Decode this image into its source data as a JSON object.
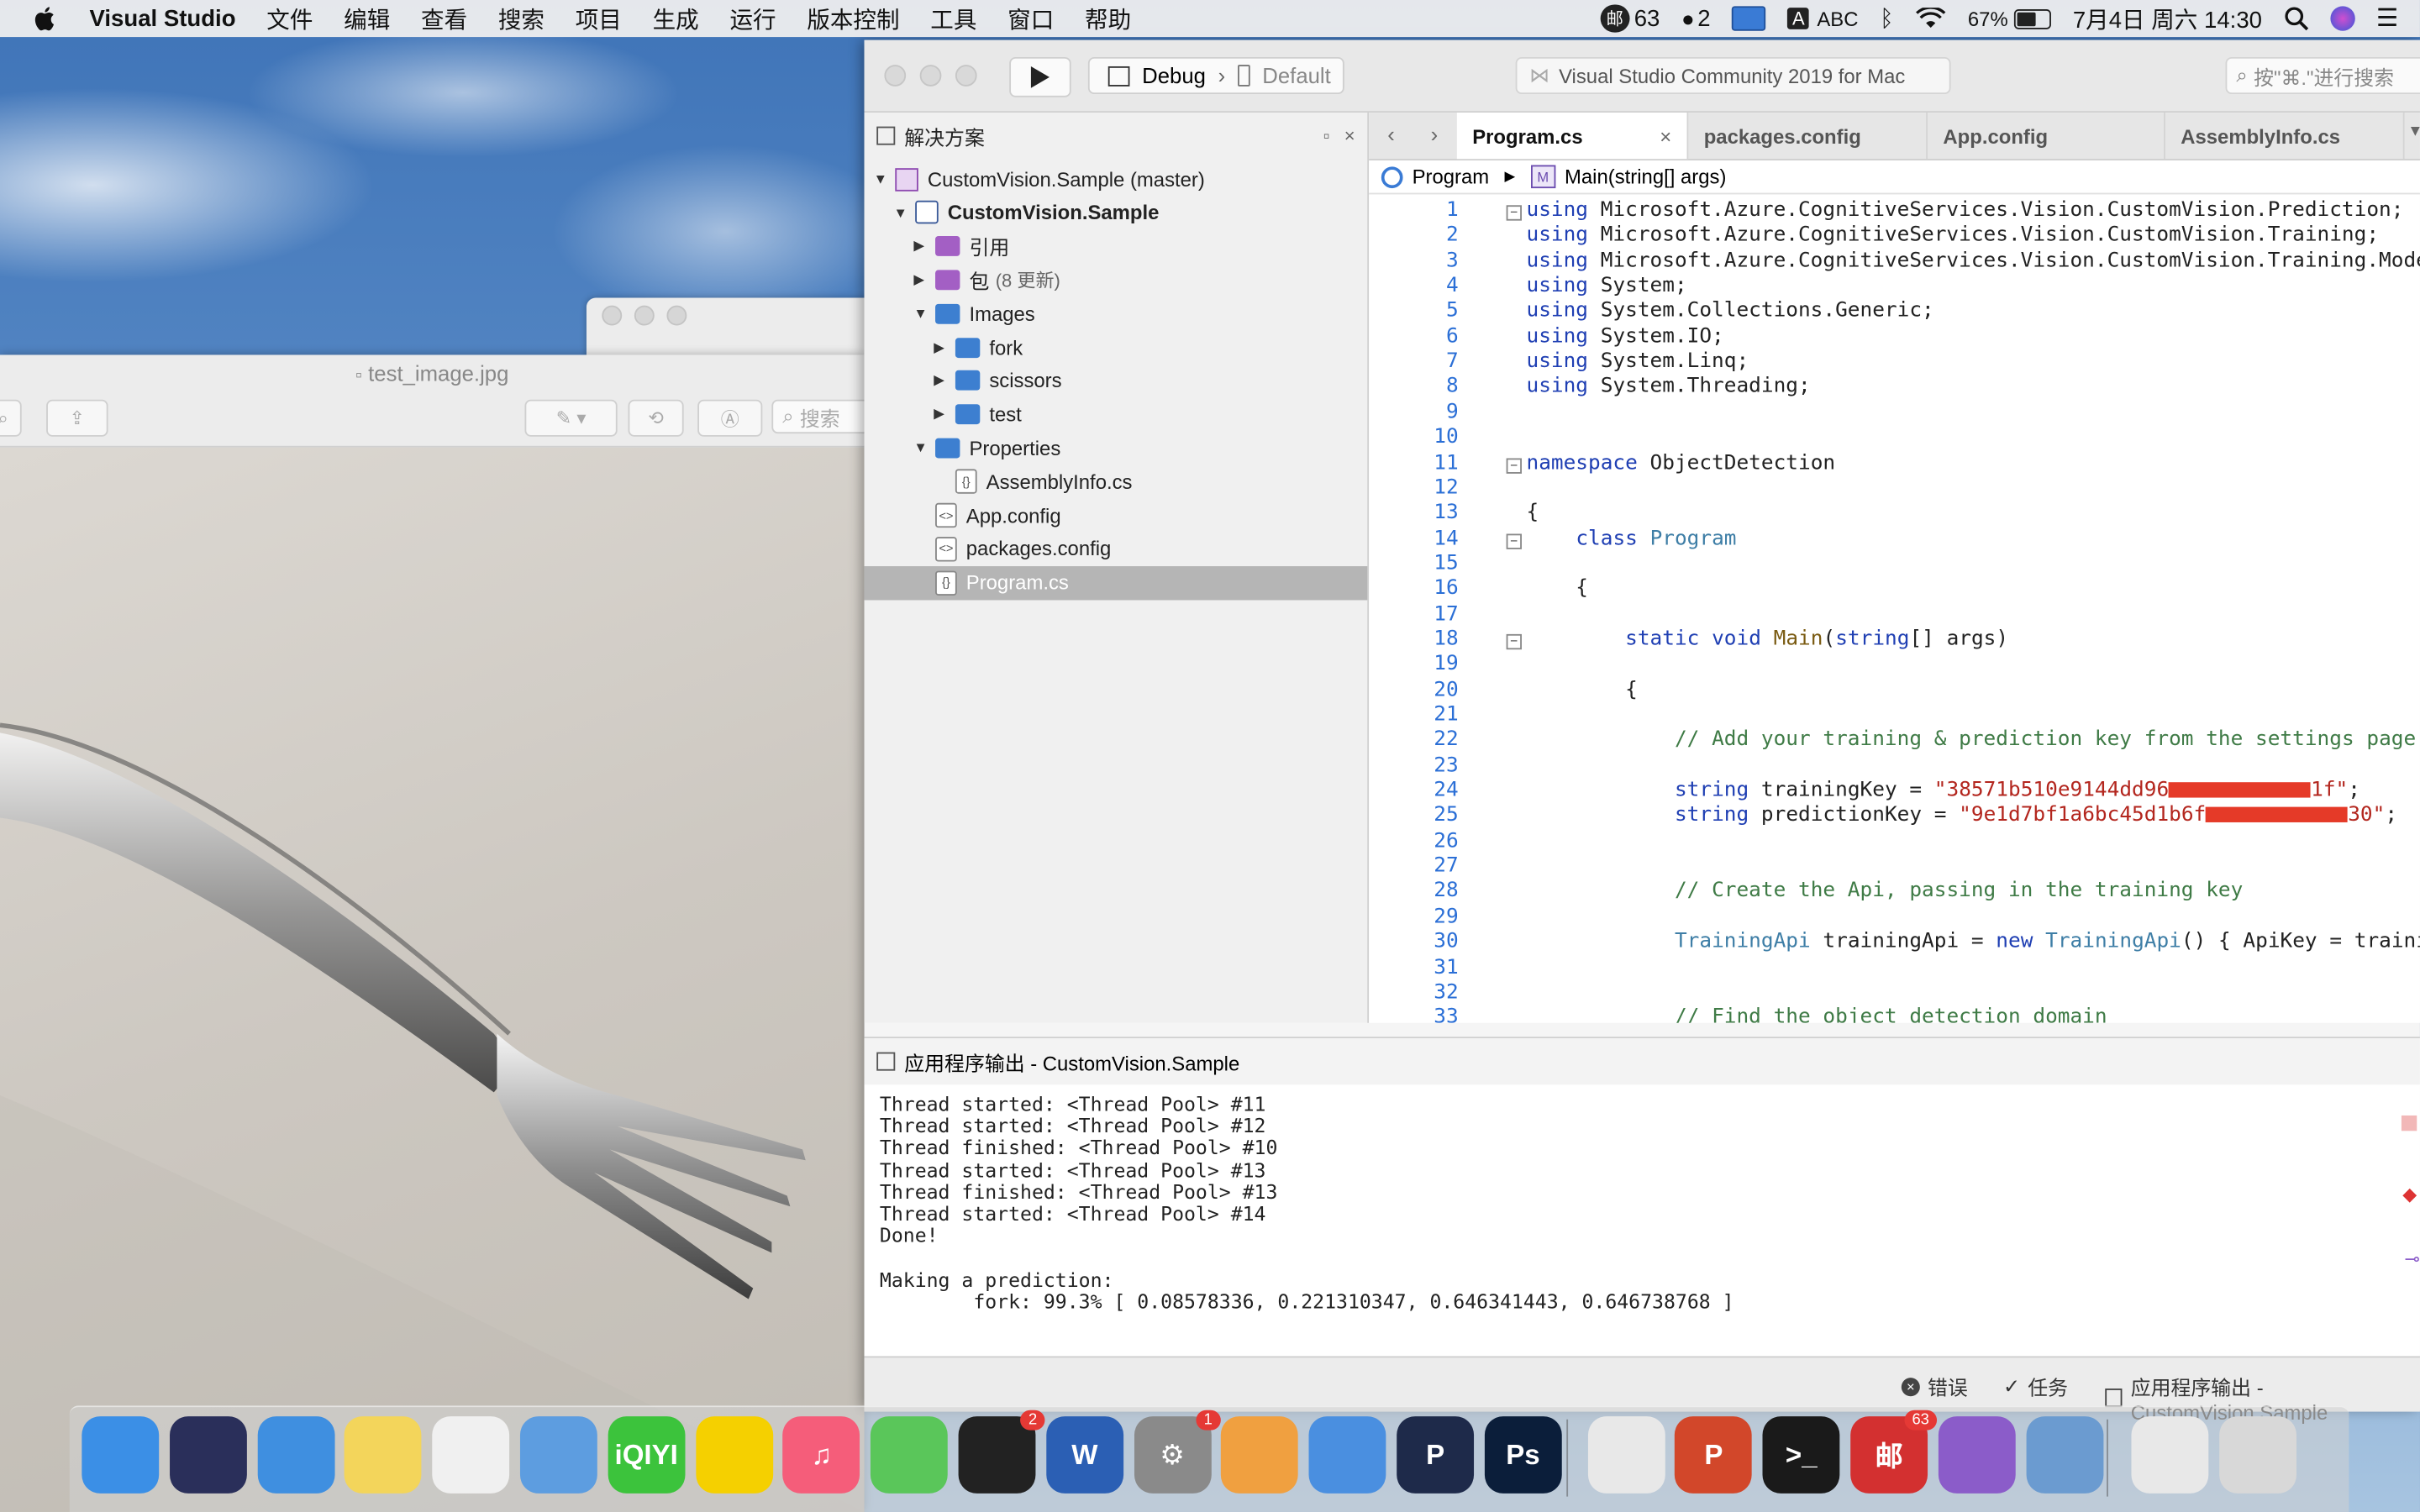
{
  "menubar": {
    "app_name": "Visual Studio",
    "menus": [
      "文件",
      "编辑",
      "查看",
      "搜索",
      "项目",
      "生成",
      "运行",
      "版本控制",
      "工具",
      "窗口",
      "帮助"
    ],
    "status": {
      "mail_badge": "63",
      "qq_badge": "2",
      "input_method": "ABC",
      "battery": "67%",
      "battery_level": 0.67,
      "datetime": "7月4日 周六  14:30"
    }
  },
  "preview": {
    "title": "test_image.jpg",
    "search_placeholder": "搜索"
  },
  "vs": {
    "config": "Debug",
    "target": "Default",
    "window_title": "Visual Studio Community 2019 for Mac",
    "search_placeholder": "按\"⌘.\"进行搜索",
    "solution_pad_title": "解决方案",
    "tree": [
      {
        "label": "CustomVision.Sample (master)",
        "level": 0,
        "arrow": "▼",
        "icon": "solution-icon"
      },
      {
        "label": "CustomVision.Sample",
        "level": 1,
        "arrow": "▼",
        "icon": "project-icon",
        "bold": true
      },
      {
        "label": "引用",
        "level": 2,
        "arrow": "▶",
        "icon": "references-icon"
      },
      {
        "label": "包",
        "extra": "(8 更新)",
        "level": 2,
        "arrow": "▶",
        "icon": "packages-icon"
      },
      {
        "label": "Images",
        "level": 2,
        "arrow": "▼",
        "icon": "folder-icon"
      },
      {
        "label": "fork",
        "level": 3,
        "arrow": "▶",
        "icon": "folder-icon"
      },
      {
        "label": "scissors",
        "level": 3,
        "arrow": "▶",
        "icon": "folder-icon"
      },
      {
        "label": "test",
        "level": 3,
        "arrow": "▶",
        "icon": "folder-icon"
      },
      {
        "label": "Properties",
        "level": 2,
        "arrow": "▼",
        "icon": "folder-icon"
      },
      {
        "label": "AssemblyInfo.cs",
        "level": 3,
        "arrow": "",
        "icon": "cs-file-icon"
      },
      {
        "label": "App.config",
        "level": 2,
        "arrow": "",
        "icon": "config-file-icon"
      },
      {
        "label": "packages.config",
        "level": 2,
        "arrow": "",
        "icon": "config-file-icon"
      },
      {
        "label": "Program.cs",
        "level": 2,
        "arrow": "",
        "icon": "cs-file-icon",
        "selected": true
      }
    ],
    "tabs": [
      {
        "label": "Program.cs",
        "active": true
      },
      {
        "label": "packages.config"
      },
      {
        "label": "App.config"
      },
      {
        "label": "AssemblyInfo.cs"
      }
    ],
    "breadcrumb": {
      "class_name": "Program",
      "method": "Main(string[] args)"
    },
    "code_lines": [
      {
        "n": "1",
        "fold": true,
        "text": "using Microsoft.Azure.CognitiveServices.Vision.CustomVision.Prediction;"
      },
      {
        "n": "2",
        "text": "using Microsoft.Azure.CognitiveServices.Vision.CustomVision.Training;"
      },
      {
        "n": "3",
        "text": "using Microsoft.Azure.CognitiveServices.Vision.CustomVision.Training.Models;"
      },
      {
        "n": "4",
        "text": "using System;"
      },
      {
        "n": "5",
        "text": "using System.Collections.Generic;"
      },
      {
        "n": "6",
        "text": "using System.IO;"
      },
      {
        "n": "7",
        "text": "using System.Linq;"
      },
      {
        "n": "8",
        "text": "using System.Threading;"
      },
      {
        "n": "9",
        "text": ""
      },
      {
        "n": "10",
        "text": ""
      },
      {
        "n": "11",
        "fold": true,
        "text": "namespace ObjectDetection"
      },
      {
        "n": "12",
        "text": ""
      },
      {
        "n": "13",
        "text": "{"
      },
      {
        "n": "14",
        "fold": true,
        "text": "    class Program"
      },
      {
        "n": "15",
        "text": ""
      },
      {
        "n": "16",
        "text": "    {"
      },
      {
        "n": "17",
        "text": ""
      },
      {
        "n": "18",
        "fold": true,
        "text": "        static void Main(string[] args)"
      },
      {
        "n": "19",
        "text": ""
      },
      {
        "n": "20",
        "text": "        {"
      },
      {
        "n": "21",
        "text": ""
      },
      {
        "n": "22",
        "text": "            // Add your training & prediction key from the settings page of the portal"
      },
      {
        "n": "23",
        "text": ""
      },
      {
        "n": "24",
        "text": "            string trainingKey = \"38571b510e9144dd961f\";"
      },
      {
        "n": "25",
        "text": "            string predictionKey = \"9e1d7bf1a6bc45d1b6f30\";"
      },
      {
        "n": "26",
        "text": ""
      },
      {
        "n": "27",
        "text": ""
      },
      {
        "n": "28",
        "text": "            // Create the Api, passing in the training key"
      },
      {
        "n": "29",
        "text": ""
      },
      {
        "n": "30",
        "text": "            TrainingApi trainingApi = new TrainingApi() { ApiKey = trainingKey };"
      },
      {
        "n": "31",
        "text": ""
      },
      {
        "n": "32",
        "text": ""
      },
      {
        "n": "33",
        "text": "            // Find the object detection domain"
      }
    ],
    "output": {
      "title": "应用程序输出 - CustomVision.Sample",
      "lines": [
        "Thread started: <Thread Pool> #11",
        "Thread started: <Thread Pool> #12",
        "Thread finished: <Thread Pool> #10",
        "Thread started: <Thread Pool> #13",
        "Thread finished: <Thread Pool> #13",
        "Thread started: <Thread Pool> #14",
        "Done!",
        "",
        "Making a prediction:",
        "        fork: 99.3% [ 0.08578336, 0.221310347, 0.646341443, 0.646738768 ]"
      ]
    },
    "statusbar": {
      "errors": "错误",
      "tasks": "任务",
      "app_output": "应用程序输出 - CustomVision.Sample"
    }
  },
  "dock": {
    "apps": [
      {
        "name": "Finder",
        "color": "#3b8fe6",
        "glyph": ""
      },
      {
        "name": "Siri",
        "color": "#2a2f5a",
        "glyph": ""
      },
      {
        "name": "Safari",
        "color": "#3f8fe0",
        "glyph": ""
      },
      {
        "name": "Notes",
        "color": "#f3d55b",
        "glyph": ""
      },
      {
        "name": "Photos",
        "color": "#f0f0f0",
        "glyph": ""
      },
      {
        "name": "Keynote",
        "color": "#5d9de0",
        "glyph": ""
      },
      {
        "name": "iQIYI",
        "color": "#3cc33c",
        "glyph": "iQIYI"
      },
      {
        "name": "QQ Music",
        "color": "#f5d000",
        "glyph": ""
      },
      {
        "name": "Music",
        "color": "#f55d7a",
        "glyph": "♫"
      },
      {
        "name": "WeChat",
        "color": "#5ac65a",
        "glyph": ""
      },
      {
        "name": "QQ",
        "color": "#222222",
        "glyph": "",
        "badge": "2"
      },
      {
        "name": "Word",
        "color": "#2b5fb4",
        "glyph": "W"
      },
      {
        "name": "System Preferences",
        "color": "#8a8a8a",
        "glyph": "⚙",
        "badge": "1"
      },
      {
        "name": "Pages",
        "color": "#f0a040",
        "glyph": ""
      },
      {
        "name": "Xcode",
        "color": "#4a8fe0",
        "glyph": ""
      },
      {
        "name": "P App",
        "color": "#1e2a4a",
        "glyph": "P"
      },
      {
        "name": "Photoshop",
        "color": "#0b1e3a",
        "glyph": "Ps"
      },
      {
        "name": "Chrome",
        "color": "#e8e8e8",
        "glyph": ""
      },
      {
        "name": "PowerPoint",
        "color": "#d2472a",
        "glyph": "P"
      },
      {
        "name": "Terminal",
        "color": "#1a1a1a",
        "glyph": ">_"
      },
      {
        "name": "NetEase Mail",
        "color": "#d33030",
        "glyph": "邮",
        "badge": "63"
      },
      {
        "name": "Visual Studio",
        "color": "#8b5cc9",
        "glyph": ""
      },
      {
        "name": "Preview",
        "color": "#6b9bd0",
        "glyph": ""
      },
      {
        "name": "Documents",
        "color": "#e8e8e8",
        "glyph": ""
      },
      {
        "name": "Trash",
        "color": "#d8d8d8",
        "glyph": ""
      }
    ]
  },
  "colors": {
    "accent": "#3d7fd0",
    "selection": "#b5b5b5",
    "redaction": "#e53a28"
  }
}
